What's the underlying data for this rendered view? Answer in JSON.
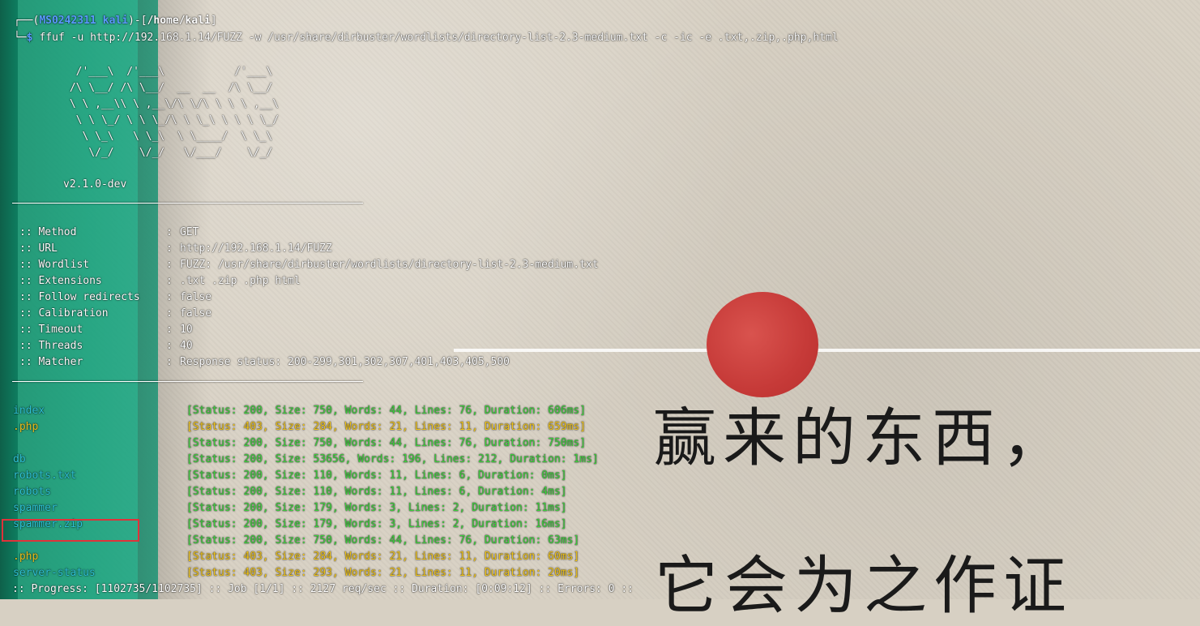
{
  "prompt": {
    "corner_top": "┌──(",
    "user": "MS0242311",
    "host": "kali",
    "bracket_open": ")-[",
    "path": "/home/kali",
    "bracket_close": "]",
    "corner_bottom": "└─",
    "symbol": "$",
    "command": "ffuf -u http://192.168.1.14/FUZZ -w /usr/share/dirbuster/wordlists/directory-list-2.3-medium.txt -c -ic -e .txt,.zip,.php,html"
  },
  "banner": {
    "art": [
      "  /'___\\  /'___\\           /'___\\",
      " /\\ \\__/ /\\ \\__/  __  __  /\\ \\__/",
      " \\ \\ ,__\\\\ \\ ,__\\/\\ \\/\\ \\ \\ \\ ,__\\",
      "  \\ \\ \\_/ \\ \\ \\_/\\ \\ \\_\\ \\ \\ \\ \\_/",
      "   \\ \\_\\   \\ \\_\\  \\ \\____/  \\ \\_\\",
      "    \\/_/    \\/_/   \\/___/    \\/_/"
    ],
    "version": "v2.1.0-dev"
  },
  "config": [
    {
      "key": ":: Method",
      "value": "GET"
    },
    {
      "key": ":: URL",
      "value": "http://192.168.1.14/FUZZ"
    },
    {
      "key": ":: Wordlist",
      "value": "FUZZ: /usr/share/dirbuster/wordlists/directory-list-2.3-medium.txt"
    },
    {
      "key": ":: Extensions",
      "value": ".txt .zip .php html"
    },
    {
      "key": ":: Follow redirects",
      "value": "false"
    },
    {
      "key": ":: Calibration",
      "value": "false"
    },
    {
      "key": ":: Timeout",
      "value": "10"
    },
    {
      "key": ":: Threads",
      "value": "40"
    },
    {
      "key": ":: Matcher",
      "value": "Response status: 200-299,301,302,307,401,403,405,500"
    }
  ],
  "config_sep": ":",
  "results": [
    {
      "name": "index",
      "status": "[Status: 200, Size: 750, Words: 44, Lines: 76, Duration: 606ms]"
    },
    {
      "name": ".php",
      "status": "[Status: 403, Size: 284, Words: 21, Lines: 11, Duration: 659ms]"
    },
    {
      "name": "",
      "status": "[Status: 200, Size: 750, Words: 44, Lines: 76, Duration: 750ms]"
    },
    {
      "name": "db",
      "status": "[Status: 200, Size: 53656, Words: 196, Lines: 212, Duration: 1ms]"
    },
    {
      "name": "robots.txt",
      "status": "[Status: 200, Size: 110, Words: 11, Lines: 6, Duration: 0ms]"
    },
    {
      "name": "robots",
      "status": "[Status: 200, Size: 110, Words: 11, Lines: 6, Duration: 4ms]"
    },
    {
      "name": "spammer",
      "status": "[Status: 200, Size: 179, Words: 3, Lines: 2, Duration: 11ms]"
    },
    {
      "name": "spammer.zip",
      "status": "[Status: 200, Size: 179, Words: 3, Lines: 2, Duration: 16ms]"
    },
    {
      "name": "",
      "status": "[Status: 200, Size: 750, Words: 44, Lines: 76, Duration: 63ms]"
    },
    {
      "name": ".php",
      "status": "[Status: 403, Size: 284, Words: 21, Lines: 11, Duration: 60ms]"
    },
    {
      "name": "server-status",
      "status": "[Status: 403, Size: 293, Words: 21, Lines: 11, Duration: 20ms]"
    }
  ],
  "progress": ":: Progress: [1102735/1102735] :: Job [1/1] :: 2127 req/sec :: Duration: [0:09:12] :: Errors: 0 ::",
  "background": {
    "text_line1": "赢来的东西，",
    "text_line2": "它会为之作证"
  },
  "colors": {
    "prompt_blue": "#5a9bff",
    "status_ok": "#3dd13d",
    "status_forbidden": "#f0c419",
    "result_name": "#2ec4d6",
    "highlight_box": "#e0323a"
  }
}
